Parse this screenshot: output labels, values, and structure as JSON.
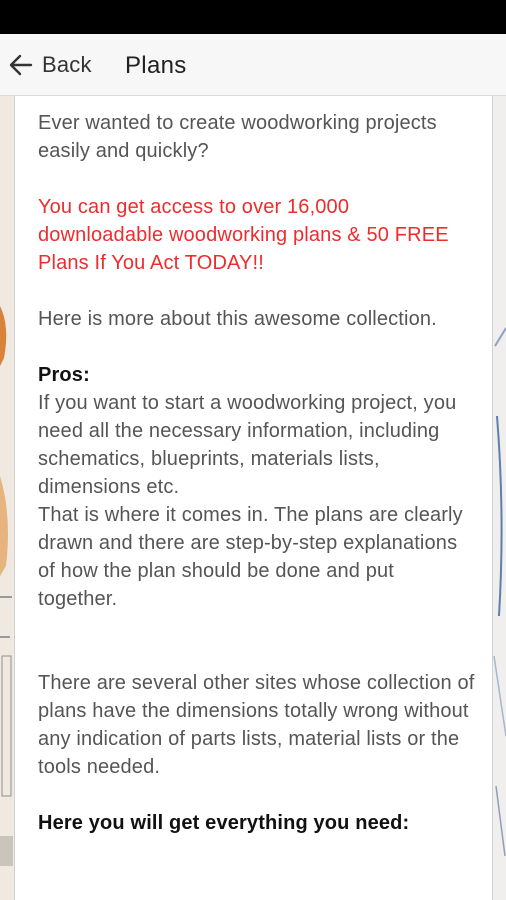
{
  "app_bar": {
    "back_label": "Back",
    "title": "Plans"
  },
  "article": {
    "intro": "Ever wanted to create woodworking projects easily and quickly?",
    "promo": "You can get access to over 16,000 downloadable woodworking plans & 50 FREE Plans If You Act TODAY!!",
    "more_about": "Here is more about this awesome collection.",
    "pros_heading": "Pros:",
    "pros_text_1": "If you want to start a woodworking project, you need all the necessary information, including schematics, blueprints, materials lists, dimensions etc.",
    "pros_text_2": "That is where it comes in. The plans are clearly drawn and there are step-by-step explanations of how the plan should be done and put together.",
    "other_sites": "There are several other sites whose collection of plans have the dimensions totally wrong without any indication of parts lists, material lists or the tools needed.",
    "everything_heading": "Here you will get everything you need:"
  },
  "colors": {
    "promo_text": "#ee2c2c",
    "body_text": "#555555",
    "status_bar": "#000000",
    "app_bar": "#f7f7f7"
  },
  "icons": {
    "back": "arrow-left-icon"
  }
}
